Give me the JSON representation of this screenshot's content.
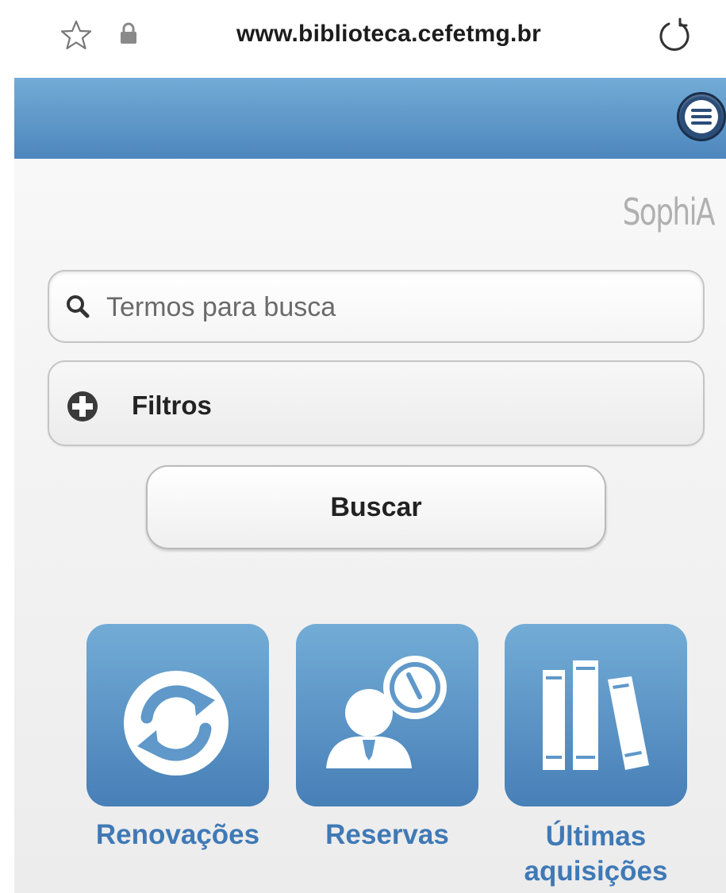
{
  "browser": {
    "url": "www.biblioteca.cefetmg.br",
    "icons": [
      "star-icon",
      "lock-icon",
      "reload-icon"
    ]
  },
  "header": {
    "menu_icon": "menu-icon",
    "accent": "#4d86bd"
  },
  "brand": {
    "logo_text": "SophiA"
  },
  "search": {
    "placeholder": "Termos para busca",
    "value": "",
    "icon": "search-icon"
  },
  "filters": {
    "label": "Filtros",
    "icon": "plus-circle-icon"
  },
  "submit": {
    "label": "Buscar"
  },
  "shortcuts": [
    {
      "label": "Renovações",
      "icon": "renew-icon"
    },
    {
      "label": "Reservas",
      "icon": "reservation-icon"
    },
    {
      "label_line1": "Últimas",
      "label_line2": "aquisições",
      "icon": "books-icon"
    }
  ]
}
